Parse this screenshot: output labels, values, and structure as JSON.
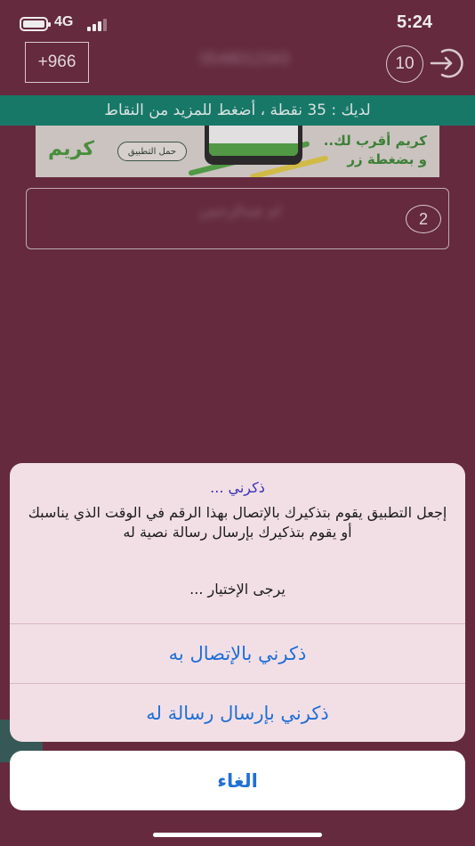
{
  "status_bar": {
    "network": "4G",
    "time": "5:24"
  },
  "header": {
    "country_code": "+966",
    "phone_number": "0548012343",
    "count": "10"
  },
  "points_banner": {
    "text": "لديك : 35 نقطة ، أضغط للمزيد من النقاط"
  },
  "ad_banner": {
    "brand": "كريم",
    "cta": "حمل التطبيق",
    "headline_line1": "كريم أقرب لك..",
    "headline_line2": "و بضغطة زر"
  },
  "list": {
    "items": [
      {
        "number": "2",
        "name": "ام عبدالرحمن"
      }
    ]
  },
  "action_sheet": {
    "title": "ذكرني ...",
    "message": "إجعل التطبيق يقوم بتذكيرك بالإتصال بهذا الرقم في الوقت الذي يناسبك أو يقوم بتذكيرك بإرسال رسالة نصية له",
    "hint": "يرجى الإختيار ...",
    "actions": [
      "ذكرني بالإتصال به",
      "ذكرني بإرسال رسالة له"
    ],
    "cancel": "الغاء"
  },
  "colors": {
    "background": "#6b2d42",
    "banner": "#16826f",
    "sheet": "#f2dfe6",
    "action_blue": "#1f6fd6",
    "title_blue": "#3a31b3"
  }
}
